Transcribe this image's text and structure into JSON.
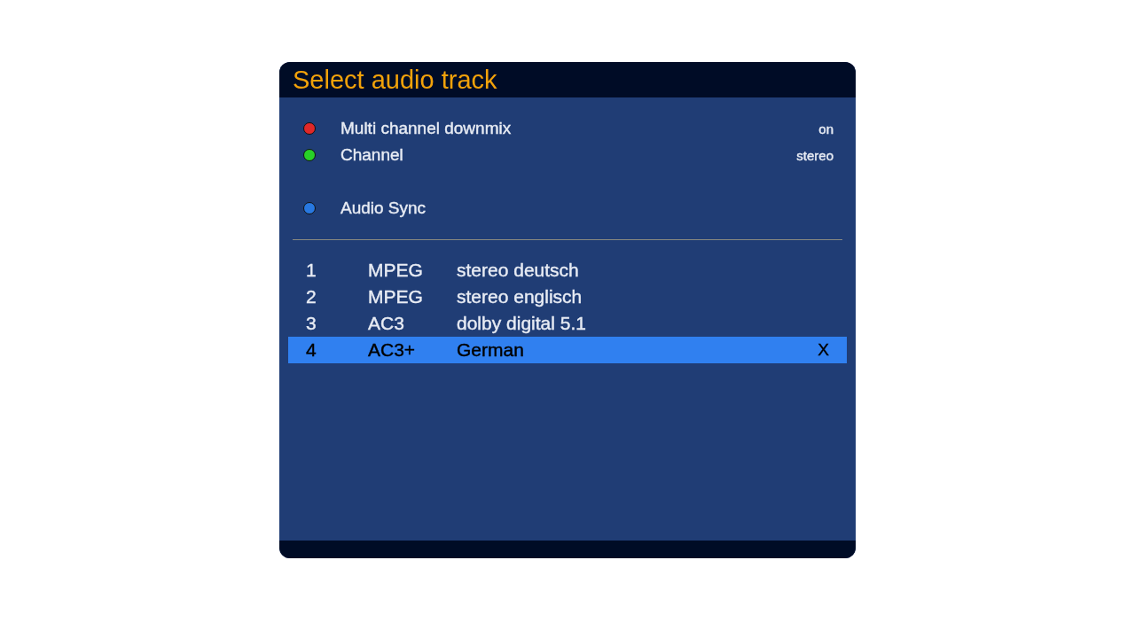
{
  "window": {
    "title": "Select audio track"
  },
  "options": [
    {
      "label": "Multi channel downmix",
      "value": "on",
      "color": "#e02828"
    },
    {
      "label": "Channel",
      "value": "stereo",
      "color": "#28d028"
    },
    {
      "label": "Audio Sync",
      "color": "#2878e0"
    }
  ],
  "tracks": [
    {
      "number": "1",
      "codec": "MPEG",
      "description": "stereo deutsch",
      "selected": false
    },
    {
      "number": "2",
      "codec": "MPEG",
      "description": "stereo englisch",
      "selected": false
    },
    {
      "number": "3",
      "codec": "AC3",
      "description": "dolby digital 5.1",
      "selected": false
    },
    {
      "number": "4",
      "codec": "AC3+",
      "description": "German",
      "marker": "X",
      "selected": true
    }
  ]
}
